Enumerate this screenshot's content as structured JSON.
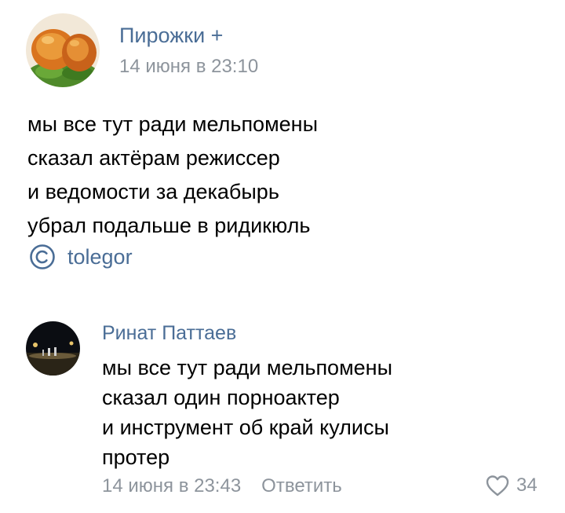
{
  "post": {
    "author": "Пирожки +",
    "date": "14 июня в 23:10",
    "lines": [
      "мы все тут ради мельпомены",
      "сказал актёрам режиссер",
      "и ведомости за декабырь",
      "убрал подальше в ридикюль"
    ],
    "copyright_icon": "copyright-icon",
    "copyright_author": "tolegor"
  },
  "comment": {
    "author": "Ринат Паттаев",
    "lines": [
      "мы все тут ради мельпомены",
      "сказал один порноактер",
      "и инструмент об край кулисы",
      "протер"
    ],
    "date": "14 июня в 23:43",
    "reply_label": "Ответить",
    "like_icon": "heart-outline-icon",
    "likes": "34"
  },
  "colors": {
    "link": "#4a6d96",
    "meta": "#8d949c",
    "text": "#000000"
  }
}
